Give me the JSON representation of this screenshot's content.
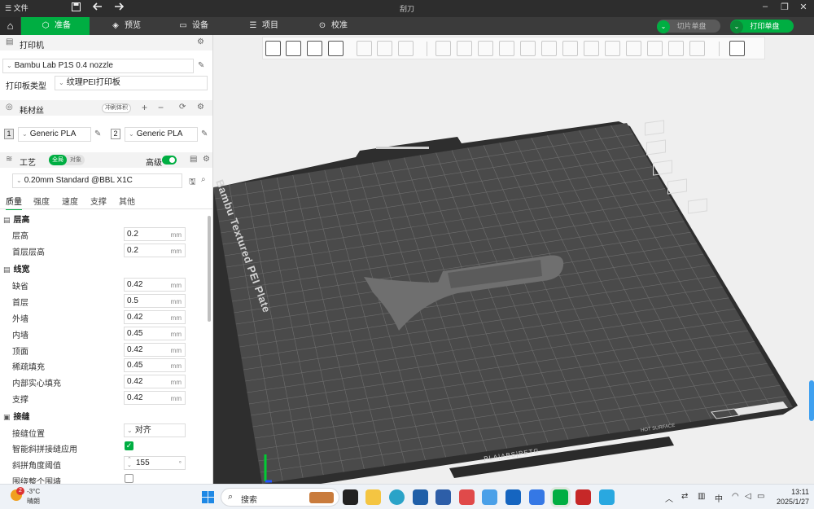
{
  "titlebar": {
    "menu_label": "文件",
    "title": "刮刀"
  },
  "tabs": [
    {
      "label": "准备",
      "icon": "cube-icon"
    },
    {
      "label": "预览",
      "icon": "layers-icon"
    },
    {
      "label": "设备",
      "icon": "monitor-icon"
    },
    {
      "label": "项目",
      "icon": "list-icon"
    },
    {
      "label": "校准",
      "icon": "target-icon"
    }
  ],
  "actions": {
    "slice": "切片单盘",
    "print": "打印单盘"
  },
  "printer": {
    "section": "打印机",
    "name": "Bambu Lab P1S 0.4 nozzle",
    "plate_label": "打印板类型",
    "plate_value": "纹理PEI打印板"
  },
  "filament": {
    "section": "耗材丝",
    "flush_label": "冲刷体积",
    "items": [
      {
        "index": "1",
        "name": "Generic PLA"
      },
      {
        "index": "2",
        "name": "Generic PLA"
      }
    ]
  },
  "process": {
    "section": "工艺",
    "toggle_global": "全局",
    "toggle_object": "对象",
    "advanced_label": "高级",
    "profile": "0.20mm Standard @BBL X1C",
    "subtabs": [
      "质量",
      "强度",
      "速度",
      "支撑",
      "其他"
    ]
  },
  "groups": {
    "layer_height": {
      "title": "层高",
      "rows": [
        {
          "label": "层高",
          "value": "0.2",
          "unit": "mm"
        },
        {
          "label": "首层层高",
          "value": "0.2",
          "unit": "mm"
        }
      ]
    },
    "line_width": {
      "title": "线宽",
      "rows": [
        {
          "label": "缺省",
          "value": "0.42",
          "unit": "mm"
        },
        {
          "label": "首层",
          "value": "0.5",
          "unit": "mm"
        },
        {
          "label": "外墙",
          "value": "0.42",
          "unit": "mm"
        },
        {
          "label": "内墙",
          "value": "0.45",
          "unit": "mm"
        },
        {
          "label": "顶面",
          "value": "0.42",
          "unit": "mm"
        },
        {
          "label": "稀疏填充",
          "value": "0.45",
          "unit": "mm"
        },
        {
          "label": "内部实心填充",
          "value": "0.42",
          "unit": "mm"
        },
        {
          "label": "支撑",
          "value": "0.42",
          "unit": "mm"
        }
      ]
    },
    "seam": {
      "title": "接缝",
      "position_label": "接缝位置",
      "position_value": "对齐",
      "smart_label": "智能斜拼接缝应用",
      "angle_label": "斜拼角度阈值",
      "angle_value": "155",
      "angle_unit": "°",
      "wrap_label": "围绕整个围墙"
    }
  },
  "plate": {
    "brand_text": "Bambu Textured PEI Plate",
    "materials_text": "PLA|ABS|PETG",
    "hot_surface_text": "HOT SURFACE"
  },
  "taskbar": {
    "weather_temp": "-3°C",
    "weather_desc": "晴朗",
    "weather_badge": "2",
    "search_placeholder": "搜索",
    "ime": "中",
    "time": "13:11",
    "date": "2025/1/27"
  },
  "colors": {
    "accent": "#00ae42",
    "plate": "#4a4a4a",
    "plate_edge": "#2e2e2e",
    "part": "#6f6f6f"
  }
}
